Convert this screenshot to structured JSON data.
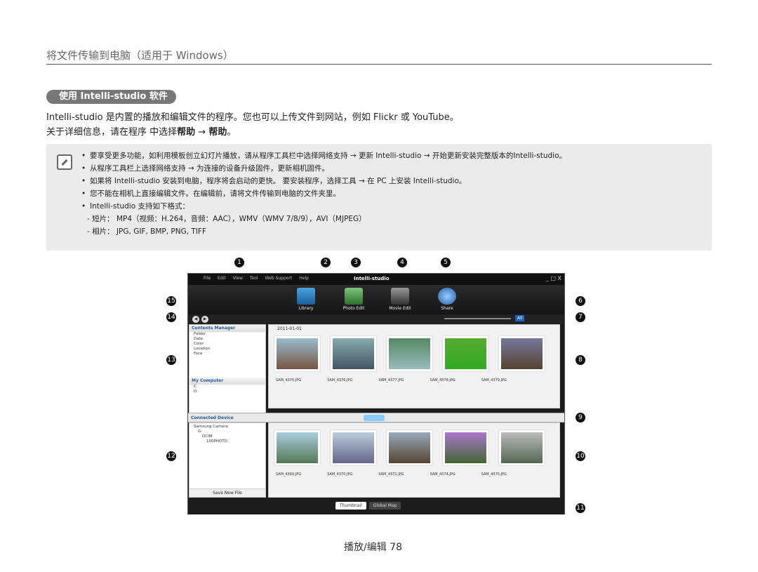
{
  "header": {
    "title": "将文件传输到电脑（适用于 Windows）"
  },
  "section": {
    "title": "使用 Intelli-studio 软件"
  },
  "intro": {
    "line1": "Intelli-studio 是内置的播放和编辑文件的程序。您也可以上传文件到网站，例如 Flickr 或 YouTube。",
    "line2_prefix": "关于详细信息，请在程序 中选择",
    "line2_help1": "帮助",
    "line2_arrow": " → ",
    "line2_help2": "帮助",
    "line2_suffix": "。"
  },
  "notes": {
    "items": [
      "要享受更多功能，如利用模板创立幻灯片播放，请从程序工具栏中选择网络支持 → 更新 Intelli-studio → 开始更新安装完整版本的Intelli-studio。",
      "从程序工具栏上选择网络支持 → 为连接的设备升级固件，更新相机固件。",
      "如果将 Intelli-studio 安装到电脑，程序将会启动的更快。 要安装程序，选择工具 → 在 PC 上安装 Intelli-studio。",
      "您不能在相机上直接编辑文件。在编辑前，请将文件传输到电脑的文件夹里。",
      "Intelli-studio 支持如下格式："
    ],
    "sub": [
      "- 短片： MP4（视频：H.264，音频：AAC），WMV（WMV 7/8/9），AVI（MJPEG）",
      "- 相片： JPG, GIF, BMP, PNG, TIFF"
    ]
  },
  "app": {
    "menu": [
      "File",
      "Edit",
      "View",
      "Tool",
      "Web Support",
      "Help"
    ],
    "brand": "Intelli-studio",
    "window_controls": "_ □ X",
    "tools": [
      "Library",
      "Photo Edit",
      "Movie Edit",
      "Share"
    ],
    "view_all": "All",
    "contents_manager": "Contents Manager",
    "tree": [
      "Folder",
      "Date",
      "Color",
      "Location",
      "Face"
    ],
    "my_computer": "My Computer",
    "drives": [
      "C:",
      "D:"
    ],
    "date": "2011-01-01",
    "files_top": [
      "SAM_4375.JPG",
      "SAM_4376.JPG",
      "SAM_4377.JPG",
      "SAM_4378.JPG",
      "SAM_4379.JPG"
    ],
    "connected_device": "Connected Device",
    "device_tree": [
      "Samsung Camera",
      "G:",
      "DCIM",
      "100PHOTO"
    ],
    "save_new_file": "Save New File",
    "files_bottom": [
      "SAM_4369.JPG",
      "SAM_4370.JPG",
      "SAM_4371.JPG",
      "SAM_4374.JPG",
      "SAM_4375.JPG"
    ],
    "tab_thumbnail": "Thumbnail",
    "tab_global_map": "Global Map"
  },
  "callouts": [
    "1",
    "2",
    "3",
    "4",
    "5",
    "6",
    "7",
    "8",
    "9",
    "10",
    "11",
    "12",
    "13",
    "14",
    "15"
  ],
  "footer": {
    "text": "播放/编辑 78"
  }
}
